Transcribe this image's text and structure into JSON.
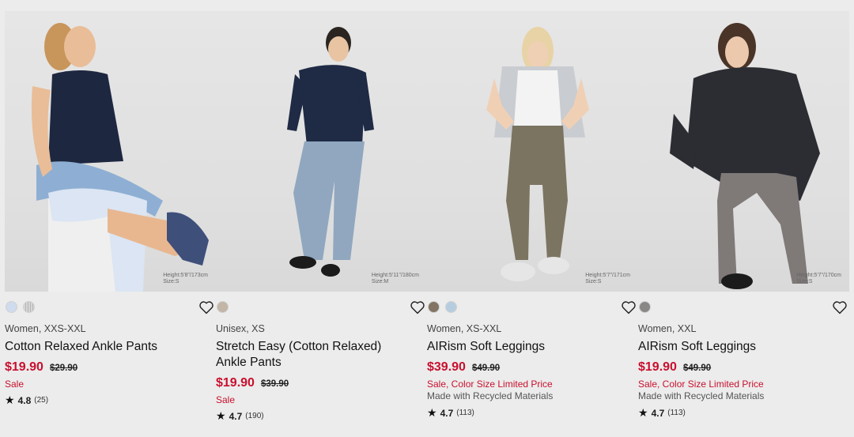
{
  "products": [
    {
      "category": "Women, XXS-XXL",
      "name": "Cotton Relaxed Ankle Pants",
      "price": "$19.90",
      "original_price": "$29.90",
      "flag": "Sale",
      "note": "",
      "rating": "4.8",
      "reviews": "(25)",
      "model_info": [
        "Height:5'8\"/173cm",
        "Size:S"
      ],
      "swatches": [
        "#cfdced",
        "#d6d6d6"
      ],
      "wishlist_icon": "heart-outline-icon"
    },
    {
      "category": "Unisex, XS",
      "name": "Stretch Easy (Cotton Relaxed) Ankle Pants",
      "price": "$19.90",
      "original_price": "$39.90",
      "flag": "Sale",
      "note": "",
      "rating": "4.7",
      "reviews": "(190)",
      "model_info": [
        "Height:5'11\"/180cm",
        "Size:M"
      ],
      "swatches": [
        "#c2b6a6"
      ],
      "wishlist_icon": "heart-outline-icon"
    },
    {
      "category": "Women, XS-XXL",
      "name": "AIRism Soft Leggings",
      "price": "$39.90",
      "original_price": "$49.90",
      "flag": "Sale, Color Size Limited Price",
      "note": "Made with Recycled Materials",
      "rating": "4.7",
      "reviews": "(113)",
      "model_info": [
        "Height:5'7\"/171cm",
        "Size:S"
      ],
      "swatches": [
        "#837563",
        "#b6cde0"
      ],
      "wishlist_icon": "heart-outline-icon"
    },
    {
      "category": "Women, XXL",
      "name": "AIRism Soft Leggings",
      "price": "$19.90",
      "original_price": "$49.90",
      "flag": "Sale, Color Size Limited Price",
      "note": "Made with Recycled Materials",
      "rating": "4.7",
      "reviews": "(113)",
      "model_info": [
        "Height:5'7\"/170cm",
        "Size:S"
      ],
      "swatches": [
        "#8a8787"
      ],
      "wishlist_icon": "heart-outline-icon"
    }
  ],
  "colors": {
    "sale_red": "#c8102e",
    "background": "#ececec"
  }
}
